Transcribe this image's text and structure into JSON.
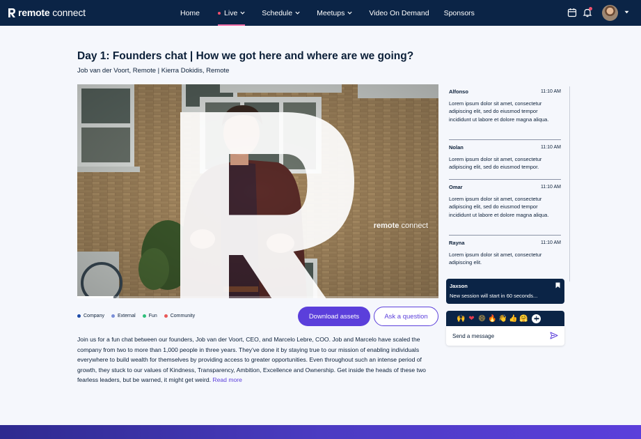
{
  "brand": {
    "name_part1": "remote",
    "name_part2": "connect"
  },
  "nav": {
    "items": [
      {
        "label": "Home",
        "dropdown": false
      },
      {
        "label": "Live",
        "dropdown": true,
        "active": true
      },
      {
        "label": "Schedule",
        "dropdown": true
      },
      {
        "label": "Meetups",
        "dropdown": true
      },
      {
        "label": "Video On Demand",
        "dropdown": false
      },
      {
        "label": "Sponsors",
        "dropdown": false
      }
    ],
    "icons": [
      "calendar-icon",
      "bell-icon"
    ]
  },
  "session": {
    "title": "Day 1: Founders chat | How we got here and where are we going?",
    "speakers": "Job van der Voort, Remote | Kierra Dokidis, Remote"
  },
  "video": {
    "watermark_part1": "remote",
    "watermark_part2": "connect",
    "progress": 0.1
  },
  "legend": [
    {
      "label": "Company",
      "color": "#1d4ba8"
    },
    {
      "label": "External",
      "color": "#7b8fd8"
    },
    {
      "label": "Fun",
      "color": "#2fbf7a"
    },
    {
      "label": "Community",
      "color": "#e85858"
    }
  ],
  "actions": {
    "download": "Download assets",
    "ask": "Ask a question"
  },
  "description": {
    "text": "Join us for a fun chat between our founders, Job van der Voort, CEO, and Marcelo Lebre, COO. Job and Marcelo have scaled the company from two to more than 1,000 people in three years. They've done it by staying true to our mission of enabling individuals everywhere to build wealth for themselves by providing access to greater opportunities. Even throughout such an intense period of growth, they stuck to our values of Kindness, Transparency, Ambition, Excellence and Ownership. Get inside the heads of these two fearless leaders, but be warned, it might get weird.",
    "read_more": "Read more"
  },
  "chat": {
    "messages": [
      {
        "name": "Alfonso",
        "time": "11:10 AM",
        "text": "Lorem ipsum dolor sit amet, consectetur adipiscing elit, sed do eiusmod tempor incididunt ut labore et dolore magna aliqua."
      },
      {
        "name": "Nolan",
        "time": "11:10 AM",
        "text": "Lorem ipsum dolor sit amet, consectetur adipiscing elit, sed do eiusmod tempor."
      },
      {
        "name": "Omar",
        "time": "11:10 AM",
        "text": "Lorem ipsum dolor sit amet, consectetur adipiscing elit, sed do eiusmod tempor incididunt ut labore et dolore magna aliqua."
      },
      {
        "name": "Rayna",
        "time": "11:10 AM",
        "text": "Lorem ipsum dolor sit amet, consectetur adipiscing elit."
      }
    ],
    "announcement": {
      "name": "Jaxson",
      "text": "New session will start in 60 seconds..."
    },
    "reactions": [
      "🙌",
      "❤",
      "😄",
      "🔥",
      "👋",
      "👍",
      "🤗"
    ],
    "input_placeholder": "Send a message"
  }
}
